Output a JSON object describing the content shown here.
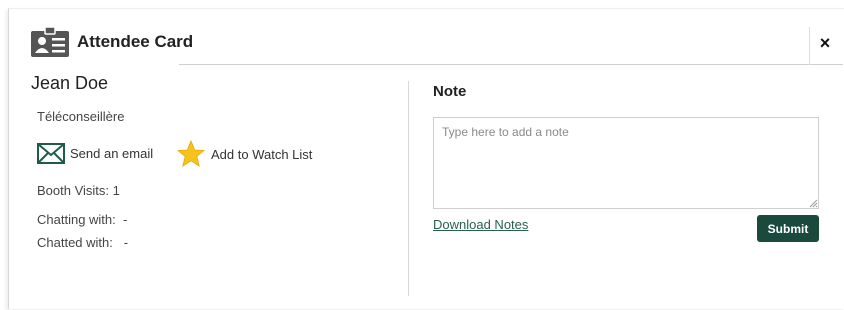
{
  "header": {
    "title": "Attendee Card",
    "icon": "id-card-icon",
    "close_label": "×"
  },
  "attendee": {
    "name": "Jean Doe",
    "role": "Téléconseillère",
    "send_email_label": "Send an email",
    "watch_list_label": "Add to Watch List",
    "booth_visits": "Booth Visits: 1",
    "chatting_with": "Chatting with:  -",
    "chatted_with": "Chatted with:   -"
  },
  "note": {
    "label": "Note",
    "placeholder": "Type here to add a note",
    "value": "",
    "download_label": "Download Notes",
    "submit_label": "Submit"
  },
  "colors": {
    "submit_bg": "#1a4a3c",
    "link": "#27614d",
    "email_icon": "#1f5c48",
    "star": "#f7c21b"
  }
}
